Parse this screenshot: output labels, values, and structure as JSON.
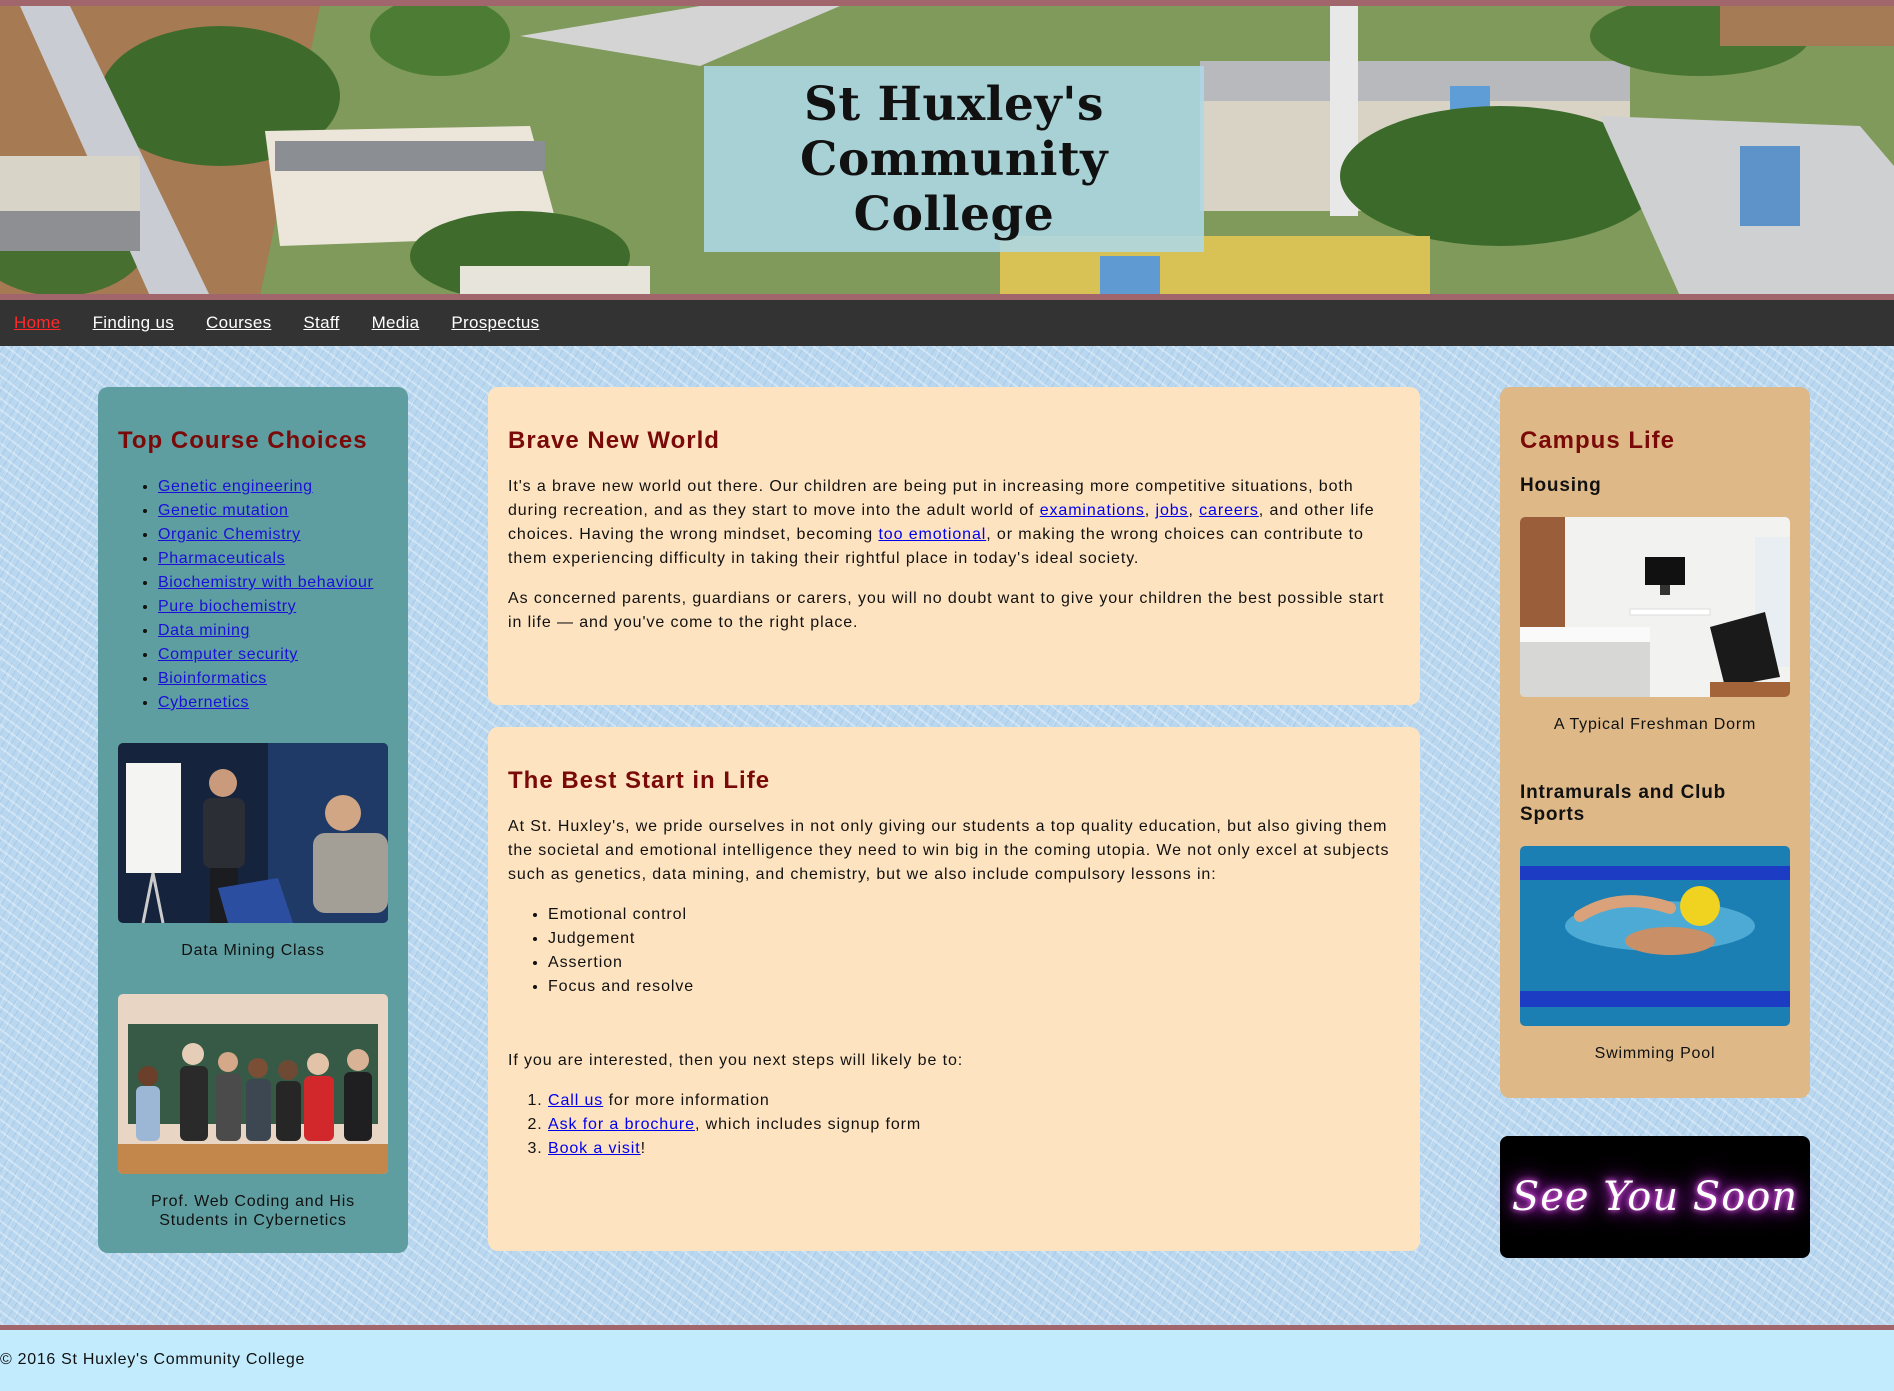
{
  "header": {
    "title": "St Huxley's Community College"
  },
  "nav": {
    "items": [
      {
        "label": "Home",
        "active": true
      },
      {
        "label": "Finding us"
      },
      {
        "label": "Courses"
      },
      {
        "label": "Staff"
      },
      {
        "label": "Media"
      },
      {
        "label": "Prospectus"
      }
    ]
  },
  "left_panel": {
    "heading": "Top Course Choices",
    "courses": [
      "Genetic engineering",
      "Genetic mutation",
      "Organic Chemistry",
      "Pharmaceuticals",
      "Biochemistry with behaviour",
      "Pure biochemistry",
      "Data mining",
      "Computer security",
      "Bioinformatics",
      "Cybernetics"
    ],
    "figures": [
      {
        "caption": "Data Mining Class"
      },
      {
        "caption": "Prof. Web Coding and His Students in Cybernetics"
      }
    ]
  },
  "brave": {
    "heading": "Brave New World",
    "p1_a": "It's a brave new world out there. Our children are being put in increasing more competitive situations, both during recreation, and as they start to move into the adult world of ",
    "link_exam": "examinations",
    "sep1": ", ",
    "link_jobs": "jobs",
    "sep2": ", ",
    "link_careers": "careers",
    "p1_b": ", and other life choices. Having the wrong mindset, becoming ",
    "link_emotional": "too emotional",
    "p1_c": ", or making the wrong choices can contribute to them experiencing difficulty in taking their rightful place in today's ideal society.",
    "p2": "As concerned parents, guardians or carers, you will no doubt want to give your children the best possible start in life — and you've come to the right place."
  },
  "best": {
    "heading": "The Best Start in Life",
    "p1": "At St. Huxley's, we pride ourselves in not only giving our students a top quality education, but also giving them the societal and emotional intelligence they need to win big in the coming utopia. We not only excel at subjects such as genetics, data mining, and chemistry, but we also include compulsory lessons in:",
    "lessons": [
      "Emotional control",
      "Judgement",
      "Assertion",
      "Focus and resolve"
    ],
    "p2": "If you are interested, then you next steps will likely be to:",
    "steps": [
      {
        "link": "Call us",
        "rest": " for more information"
      },
      {
        "link": "Ask for a brochure",
        "rest": ", which includes signup form"
      },
      {
        "link": "Book a visit",
        "rest": "!"
      }
    ]
  },
  "campus": {
    "heading": "Campus Life",
    "housing_heading": "Housing",
    "housing_caption": "A Typical Freshman Dorm",
    "sports_heading": "Intramurals and Club Sports",
    "sports_caption": "Swimming Pool"
  },
  "neon_sign": "See You Soon",
  "footer": {
    "text": "© 2016 St Huxley's Community College"
  },
  "colors": {
    "nav_bg": "#333333",
    "nav_active": "#ff2a2a",
    "left_panel": "#5f9ea0",
    "main_panel": "#fde3c0",
    "right_panel": "#deb887",
    "heading": "#7a0a0a",
    "border_accent": "#a0666c",
    "footer_bg": "#c2ecfd"
  }
}
